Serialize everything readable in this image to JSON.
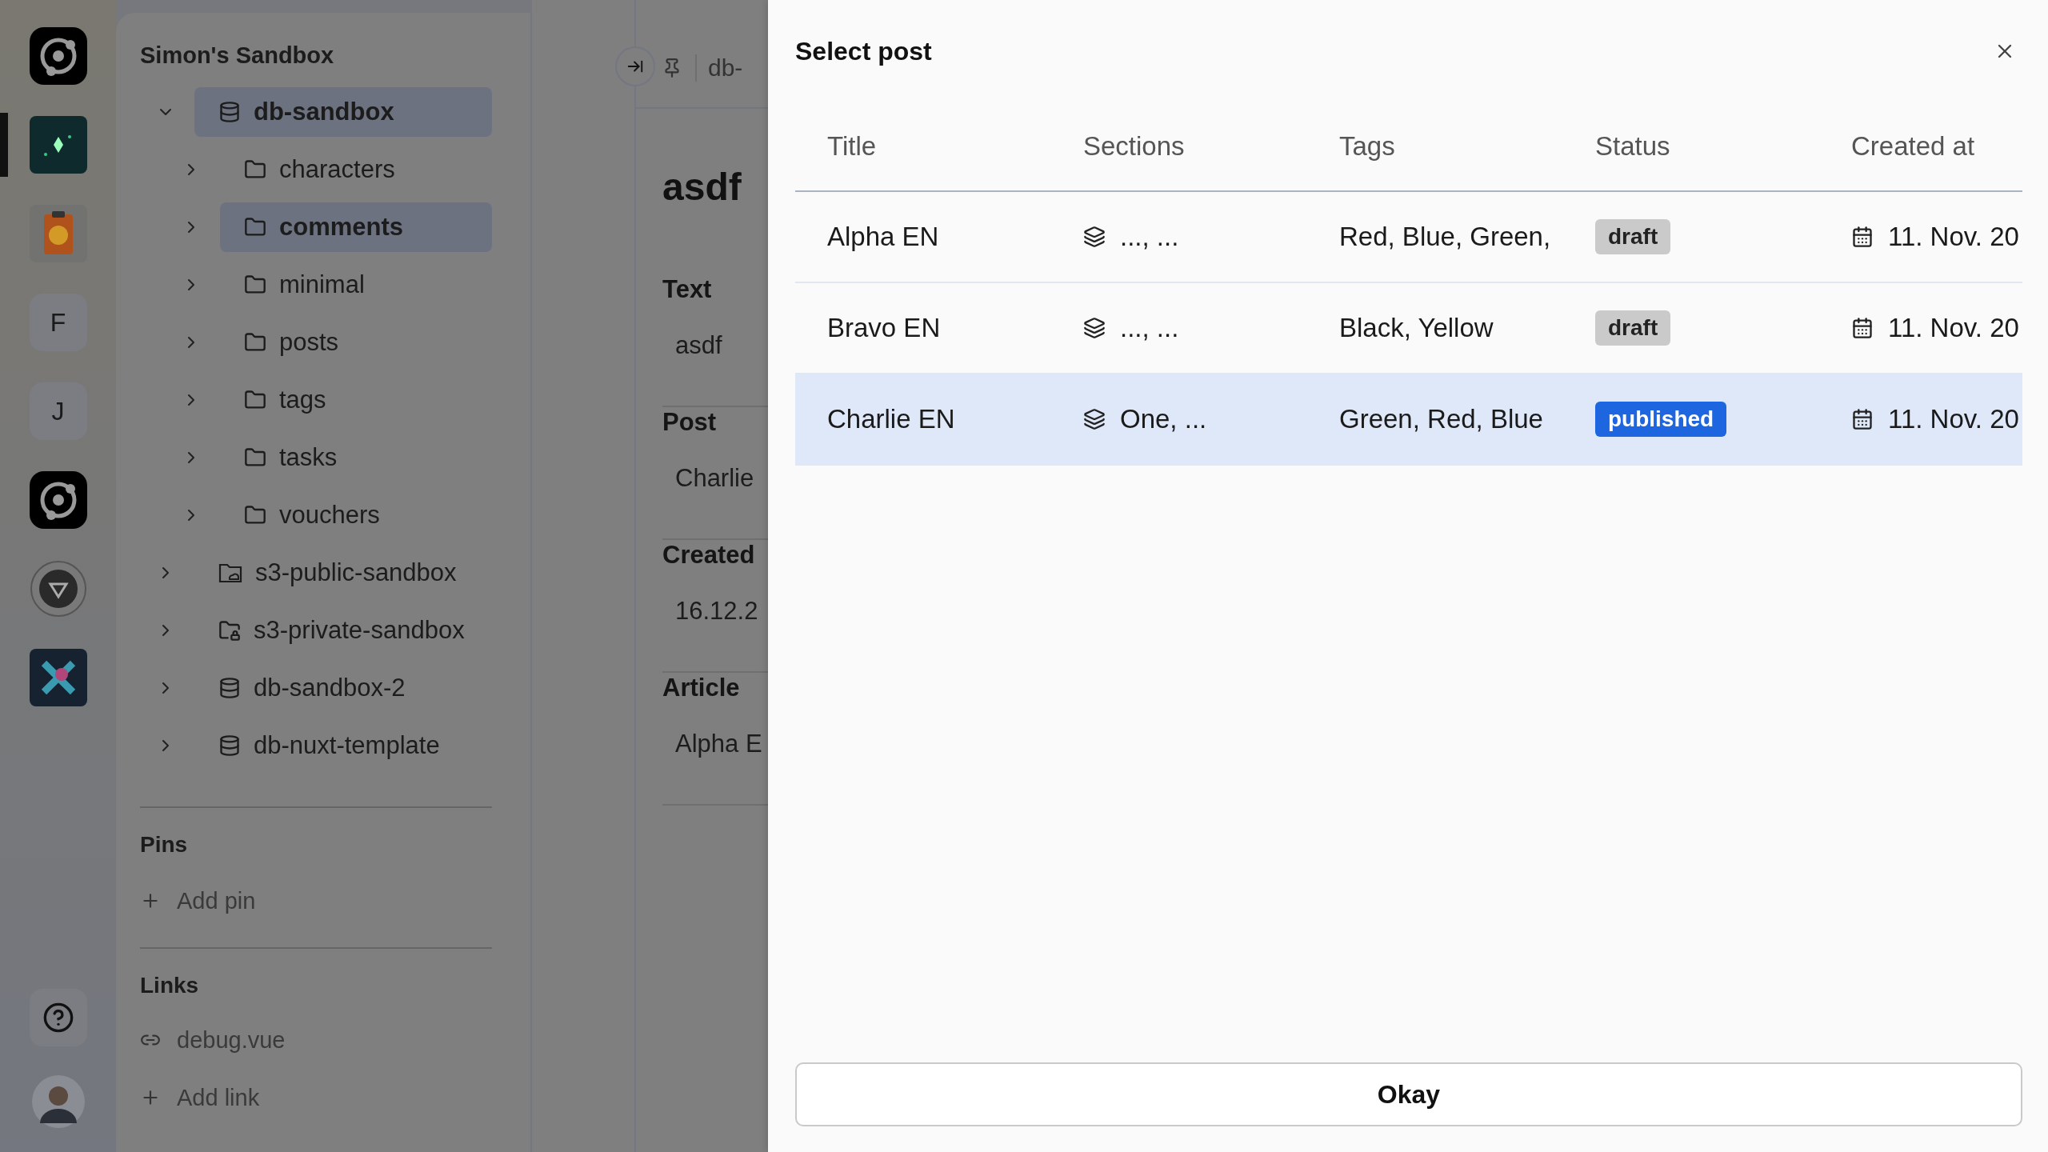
{
  "rail": {
    "apps": [
      {
        "kind": "ring",
        "selected": false
      },
      {
        "kind": "sparkle",
        "selected": true
      },
      {
        "kind": "clipboard",
        "selected": false
      },
      {
        "kind": "letter",
        "letter": "F",
        "selected": false
      },
      {
        "kind": "letter",
        "letter": "J",
        "selected": false
      },
      {
        "kind": "ring",
        "selected": false
      },
      {
        "kind": "triangle",
        "selected": false
      },
      {
        "kind": "cross",
        "selected": false
      }
    ]
  },
  "sidebar": {
    "title": "Simon's Sandbox",
    "tree": [
      {
        "label": "db-sandbox",
        "kind": "database",
        "expanded": true,
        "selected": true,
        "children": [
          {
            "label": "characters",
            "kind": "folder",
            "expanded": false,
            "selected": false
          },
          {
            "label": "comments",
            "kind": "folder",
            "expanded": false,
            "selected": true
          },
          {
            "label": "minimal",
            "kind": "folder",
            "expanded": false,
            "selected": false
          },
          {
            "label": "posts",
            "kind": "folder",
            "expanded": false,
            "selected": false
          },
          {
            "label": "tags",
            "kind": "folder",
            "expanded": false,
            "selected": false
          },
          {
            "label": "tasks",
            "kind": "folder",
            "expanded": false,
            "selected": false
          },
          {
            "label": "vouchers",
            "kind": "folder",
            "expanded": false,
            "selected": false
          }
        ]
      },
      {
        "label": "s3-public-sandbox",
        "kind": "public-bucket",
        "expanded": false,
        "selected": false
      },
      {
        "label": "s3-private-sandbox",
        "kind": "private-bucket",
        "expanded": false,
        "selected": false
      },
      {
        "label": "db-sandbox-2",
        "kind": "database",
        "expanded": false,
        "selected": false
      },
      {
        "label": "db-nuxt-template",
        "kind": "database",
        "expanded": false,
        "selected": false
      }
    ],
    "pins": {
      "heading": "Pins",
      "add": "Add pin"
    },
    "links": {
      "heading": "Links",
      "items": [
        "debug.vue"
      ],
      "add": "Add link"
    }
  },
  "editor": {
    "breadcrumb": "db-",
    "title": "asdf",
    "fields": [
      {
        "label": "Text",
        "value": "asdf"
      },
      {
        "label": "Post",
        "value": "Charlie"
      },
      {
        "label": "Created",
        "value": "16.12.2"
      },
      {
        "label": "Article",
        "value": "Alpha E"
      }
    ]
  },
  "dialog": {
    "title": "Select post",
    "columns": [
      "Title",
      "Sections",
      "Tags",
      "Status",
      "Created at"
    ],
    "rows": [
      {
        "title": "Alpha EN",
        "sections": "..., ...",
        "tags": "Red, Blue, Green,",
        "status": {
          "label": "draft",
          "kind": "draft"
        },
        "created": "11. Nov. 20",
        "selected": false
      },
      {
        "title": "Bravo EN",
        "sections": "..., ...",
        "tags": "Black, Yellow",
        "status": {
          "label": "draft",
          "kind": "draft"
        },
        "created": "11. Nov. 20",
        "selected": false
      },
      {
        "title": "Charlie EN",
        "sections": "One, ...",
        "tags": "Green, Red, Blue",
        "status": {
          "label": "published",
          "kind": "published"
        },
        "created": "11. Nov. 20",
        "selected": true
      }
    ],
    "confirm": "Okay"
  }
}
